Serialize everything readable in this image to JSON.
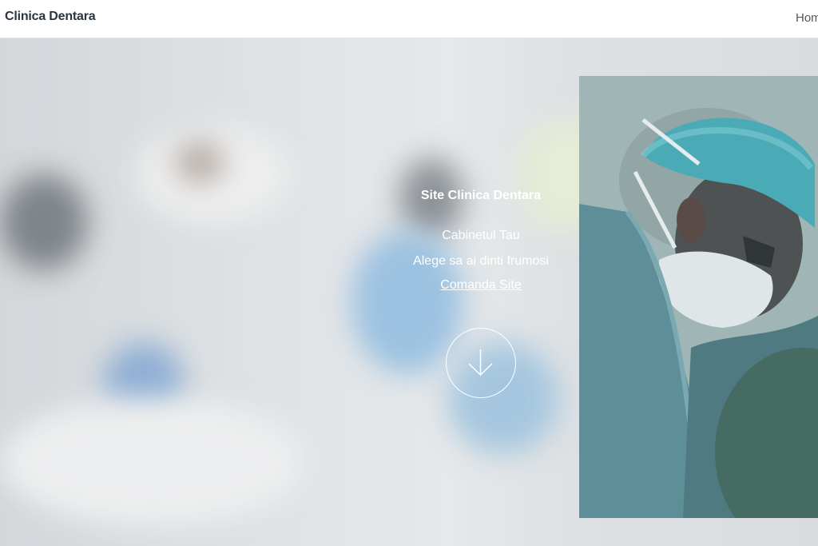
{
  "navbar": {
    "brand": "Clinica Dentara",
    "link_home": "Hom"
  },
  "hero": {
    "title": "Site Clinica Dentara",
    "subtitle": "Cabinetul Tau",
    "tagline": "Alege sa ai dinti frumosi",
    "cta_link": "Comanda Site",
    "scroll_icon": "arrow-down-circle-icon"
  },
  "colors": {
    "brand_text": "#2b3540",
    "hero_text": "#ffffff",
    "navbar_bg": "#ffffff"
  }
}
